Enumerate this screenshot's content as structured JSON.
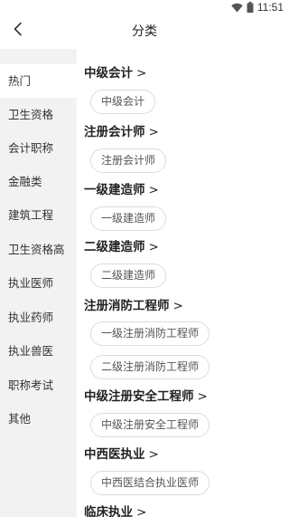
{
  "status_bar": {
    "time": "11:51",
    "wifi_icon": "wifi-icon",
    "battery_icon": "battery-icon"
  },
  "header": {
    "title": "分类",
    "back_icon": "chevron-left-icon"
  },
  "sidebar": {
    "items": [
      {
        "label": "热门",
        "active": true
      },
      {
        "label": "卫生资格"
      },
      {
        "label": "会计职称"
      },
      {
        "label": "金融类"
      },
      {
        "label": "建筑工程"
      },
      {
        "label": "卫生资格高"
      },
      {
        "label": "执业医师"
      },
      {
        "label": "执业药师"
      },
      {
        "label": "执业兽医"
      },
      {
        "label": "职称考试"
      },
      {
        "label": "其他"
      }
    ]
  },
  "sections": [
    {
      "title": "中级会计",
      "chevron": ">",
      "chips": [
        "中级会计"
      ]
    },
    {
      "title": "注册会计师",
      "chevron": ">",
      "chips": [
        "注册会计师"
      ]
    },
    {
      "title": "一级建造师",
      "chevron": ">",
      "chips": [
        "一级建造师"
      ]
    },
    {
      "title": "二级建造师",
      "chevron": ">",
      "chips": [
        "二级建造师"
      ]
    },
    {
      "title": "注册消防工程师",
      "chevron": ">",
      "chips": [
        "一级注册消防工程师",
        "二级注册消防工程师"
      ]
    },
    {
      "title": "中级注册安全工程师",
      "chevron": ">",
      "chips": [
        "中级注册安全工程师"
      ]
    },
    {
      "title": "中西医执业",
      "chevron": ">",
      "chips": [
        "中西医结合执业医师"
      ]
    },
    {
      "title": "临床执业",
      "chevron": ">",
      "chips": []
    }
  ]
}
